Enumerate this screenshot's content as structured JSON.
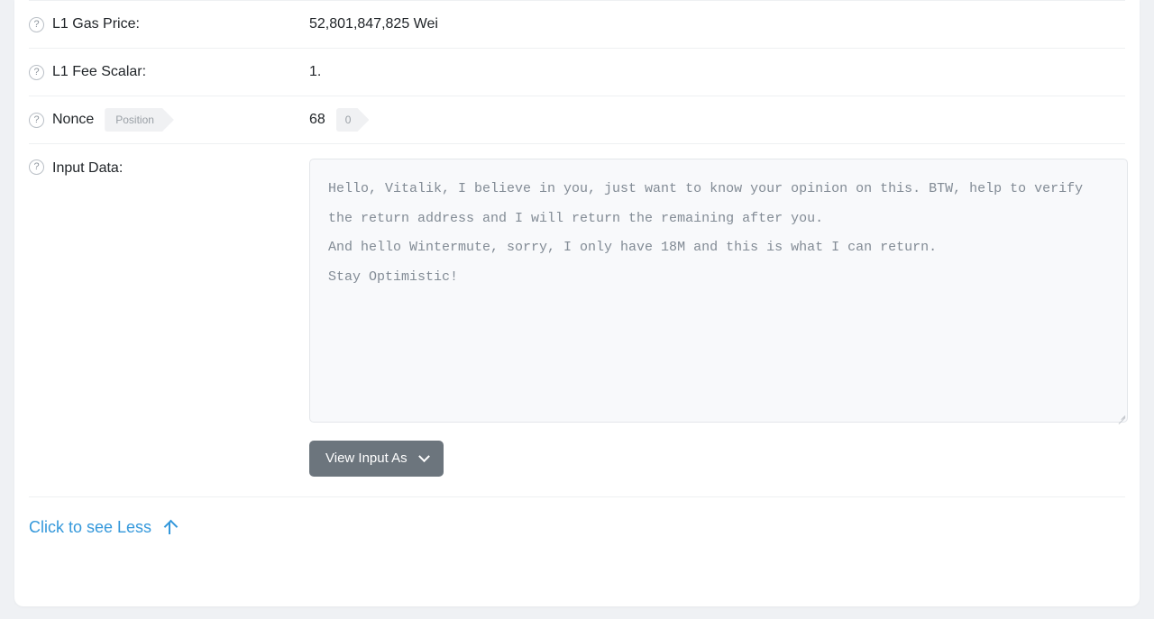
{
  "rows": [
    {
      "label": "L1 Gas Price:",
      "value": "52,801,847,825 Wei",
      "help": "help-icon"
    },
    {
      "label": "L1 Fee Scalar:",
      "value": "1.",
      "help": "help-icon"
    },
    {
      "label": "Nonce",
      "label_tag": "Position",
      "value": "68",
      "value_tag": "0",
      "help": "help-icon"
    }
  ],
  "input_data": {
    "label": "Input Data:",
    "help": "help-icon",
    "text": "Hello, Vitalik, I believe in you, just want to know your opinion on this. BTW, help to verify the return address and I will return the remaining after you.\nAnd hello Wintermute, sorry, I only have 18M and this is what I can return.\nStay Optimistic!",
    "view_as_label": "View Input As",
    "view_as_icon": "chevron-down-icon"
  },
  "footer": {
    "see_less_label": "Click to see Less",
    "see_less_icon": "arrow-up-icon"
  },
  "icons": {
    "help": "?"
  },
  "colors": {
    "link": "#3498db",
    "button": "#6c757d",
    "text": "#212529",
    "muted": "#9aa0a6",
    "card": "#ffffff",
    "page_bg": "#eff1f4",
    "divider": "#eef0f2",
    "input_bg": "#f8f9fb"
  }
}
